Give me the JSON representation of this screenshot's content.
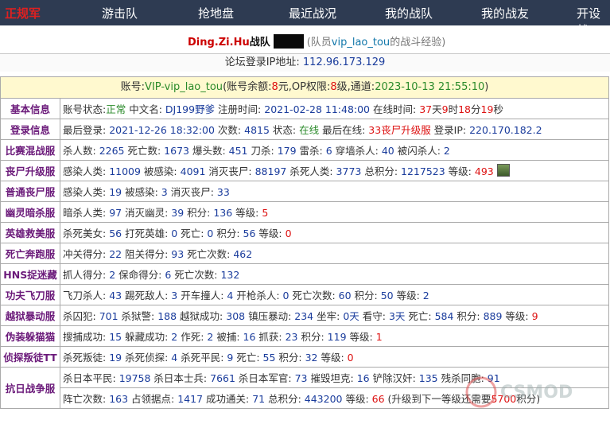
{
  "nav": {
    "logo": "正规军",
    "items": [
      "游击队",
      "抢地盘",
      "最近战况",
      "我的战队",
      "我的战友",
      "开设战"
    ]
  },
  "team": {
    "name": "Ding.Zi.Hu",
    "suffix": "战队",
    "paren_open": "(队员",
    "member": "vip_lao_tou",
    "paren_close": "的战斗经验)"
  },
  "ip": {
    "label": "论坛登录IP地址:",
    "value": "112.96.173.129"
  },
  "account": {
    "l1": "账号:",
    "name": "VIP-vip_lao_tou",
    "l2": "(账号余额:",
    "balance": "8",
    "l3": "元,OP权限:",
    "op": "8",
    "l4": "级,通道:",
    "ts": "2023-10-13 21:55:10",
    "l5": ")"
  },
  "rows": [
    {
      "label": "基本信息",
      "parts": [
        [
          "账号状态:",
          ""
        ],
        [
          "正常",
          "green"
        ],
        [
          " 中文名: ",
          ""
        ],
        [
          "DJ199野爹",
          "blue"
        ],
        [
          " 注册时间: ",
          ""
        ],
        [
          "2021-02-28 11:48:00",
          "blue"
        ],
        [
          " 在线时间: ",
          ""
        ],
        [
          "37",
          "red"
        ],
        [
          "天",
          ""
        ],
        [
          "9",
          "red"
        ],
        [
          "时",
          ""
        ],
        [
          "18",
          "red"
        ],
        [
          "分",
          ""
        ],
        [
          "19",
          "red"
        ],
        [
          "秒",
          ""
        ]
      ]
    },
    {
      "label": "登录信息",
      "parts": [
        [
          "最后登录: ",
          ""
        ],
        [
          "2021-12-26 18:32:00",
          "blue"
        ],
        [
          " 次数: ",
          ""
        ],
        [
          "4815",
          "blue"
        ],
        [
          " 状态: ",
          ""
        ],
        [
          "在线",
          "green"
        ],
        [
          " 最后在线: ",
          ""
        ],
        [
          "33丧尸升级服",
          "red"
        ],
        [
          " 登录IP: ",
          ""
        ],
        [
          "220.170.182.2",
          "blue"
        ]
      ]
    },
    {
      "label": "比赛混战服",
      "parts": [
        [
          "杀人数: ",
          ""
        ],
        [
          "2265",
          "blue"
        ],
        [
          " 死亡数: ",
          ""
        ],
        [
          "1673",
          "blue"
        ],
        [
          " 爆头数: ",
          ""
        ],
        [
          "451",
          "blue"
        ],
        [
          " 刀杀: ",
          ""
        ],
        [
          "179",
          "blue"
        ],
        [
          " 雷杀: ",
          ""
        ],
        [
          "6",
          "blue"
        ],
        [
          " 穿墙杀人: ",
          ""
        ],
        [
          "40",
          "blue"
        ],
        [
          " 被闪杀人: ",
          ""
        ],
        [
          "2",
          "blue"
        ]
      ]
    },
    {
      "label": "丧尸升级服",
      "parts": [
        [
          "感染人类: ",
          ""
        ],
        [
          "11009",
          "blue"
        ],
        [
          " 被感染: ",
          ""
        ],
        [
          "4091",
          "blue"
        ],
        [
          " 消灭丧尸: ",
          ""
        ],
        [
          "88197",
          "blue"
        ],
        [
          " 杀死人类: ",
          ""
        ],
        [
          "3773",
          "blue"
        ],
        [
          " 总积分: ",
          ""
        ],
        [
          "1217523",
          "blue"
        ],
        [
          " 等级: ",
          ""
        ],
        [
          "493",
          "red"
        ]
      ],
      "avatar": true
    },
    {
      "label": "普通丧尸服",
      "parts": [
        [
          "感染人类: ",
          ""
        ],
        [
          "19",
          "blue"
        ],
        [
          " 被感染: ",
          ""
        ],
        [
          "3",
          "blue"
        ],
        [
          " 消灭丧尸: ",
          ""
        ],
        [
          "33",
          "blue"
        ]
      ]
    },
    {
      "label": "幽灵暗杀服",
      "parts": [
        [
          "暗杀人类: ",
          ""
        ],
        [
          "97",
          "blue"
        ],
        [
          " 消灭幽灵: ",
          ""
        ],
        [
          "39",
          "blue"
        ],
        [
          " 积分: ",
          ""
        ],
        [
          "136",
          "blue"
        ],
        [
          " 等级: ",
          ""
        ],
        [
          "5",
          "red"
        ]
      ]
    },
    {
      "label": "英雄救美服",
      "parts": [
        [
          "杀死美女: ",
          ""
        ],
        [
          "56",
          "blue"
        ],
        [
          " 打死英雄: ",
          ""
        ],
        [
          "0",
          "blue"
        ],
        [
          " 死亡: ",
          ""
        ],
        [
          "0",
          "blue"
        ],
        [
          " 积分: ",
          ""
        ],
        [
          "56",
          "blue"
        ],
        [
          " 等级: ",
          ""
        ],
        [
          "0",
          "red"
        ]
      ]
    },
    {
      "label": "死亡奔跑服",
      "parts": [
        [
          "冲关得分: ",
          ""
        ],
        [
          "22",
          "blue"
        ],
        [
          " 阻关得分: ",
          ""
        ],
        [
          "93",
          "blue"
        ],
        [
          " 死亡次数: ",
          ""
        ],
        [
          "462",
          "blue"
        ]
      ]
    },
    {
      "label": "HNS捉迷藏",
      "parts": [
        [
          "抓人得分: ",
          ""
        ],
        [
          "2",
          "blue"
        ],
        [
          " 保命得分: ",
          ""
        ],
        [
          "6",
          "blue"
        ],
        [
          " 死亡次数: ",
          ""
        ],
        [
          "132",
          "blue"
        ]
      ]
    },
    {
      "label": "功夫飞刀服",
      "parts": [
        [
          "飞刀杀人: ",
          ""
        ],
        [
          "43",
          "blue"
        ],
        [
          " 踢死敌人: ",
          ""
        ],
        [
          "3",
          "blue"
        ],
        [
          " 开车撞人: ",
          ""
        ],
        [
          "4",
          "blue"
        ],
        [
          " 开枪杀人: ",
          ""
        ],
        [
          "0",
          "blue"
        ],
        [
          " 死亡次数: ",
          ""
        ],
        [
          "60",
          "blue"
        ],
        [
          " 积分: ",
          ""
        ],
        [
          "50",
          "blue"
        ],
        [
          " 等级: ",
          ""
        ],
        [
          "2",
          "blue"
        ]
      ]
    },
    {
      "label": "越狱暴动服",
      "parts": [
        [
          "杀囚犯: ",
          ""
        ],
        [
          "701",
          "blue"
        ],
        [
          " 杀狱警: ",
          ""
        ],
        [
          "188",
          "blue"
        ],
        [
          " 越狱成功: ",
          ""
        ],
        [
          "308",
          "blue"
        ],
        [
          " 镇压暴动: ",
          ""
        ],
        [
          "234",
          "blue"
        ],
        [
          " 坐牢: ",
          ""
        ],
        [
          "0天",
          "blue"
        ],
        [
          " 看守: ",
          ""
        ],
        [
          "3天",
          "blue"
        ],
        [
          " 死亡: ",
          ""
        ],
        [
          "584",
          "blue"
        ],
        [
          " 积分: ",
          ""
        ],
        [
          "889",
          "blue"
        ],
        [
          " 等级: ",
          ""
        ],
        [
          "9",
          "red"
        ]
      ]
    },
    {
      "label": "伪装躲猫猫",
      "parts": [
        [
          "搜捕成功: ",
          ""
        ],
        [
          "15",
          "blue"
        ],
        [
          " 躲藏成功: ",
          ""
        ],
        [
          "2",
          "blue"
        ],
        [
          " 作死: ",
          ""
        ],
        [
          "2",
          "blue"
        ],
        [
          " 被捕: ",
          ""
        ],
        [
          "16",
          "blue"
        ],
        [
          " 抓获: ",
          ""
        ],
        [
          "23",
          "blue"
        ],
        [
          " 积分: ",
          ""
        ],
        [
          "119",
          "blue"
        ],
        [
          " 等级: ",
          ""
        ],
        [
          "1",
          "red"
        ]
      ]
    },
    {
      "label": "侦探叛徒TT",
      "parts": [
        [
          "杀死叛徒: ",
          ""
        ],
        [
          "19",
          "blue"
        ],
        [
          " 杀死侦探: ",
          ""
        ],
        [
          "4",
          "blue"
        ],
        [
          " 杀死平民: ",
          ""
        ],
        [
          "9",
          "blue"
        ],
        [
          " 死亡: ",
          ""
        ],
        [
          "55",
          "blue"
        ],
        [
          " 积分: ",
          ""
        ],
        [
          "32",
          "blue"
        ],
        [
          " 等级: ",
          ""
        ],
        [
          "0",
          "red"
        ]
      ]
    }
  ],
  "war": {
    "label": "抗日战争服",
    "line1": [
      [
        "杀日本平民: ",
        ""
      ],
      [
        "19758",
        "blue"
      ],
      [
        " 杀日本士兵: ",
        ""
      ],
      [
        "7661",
        "blue"
      ],
      [
        " 杀日本军官: ",
        ""
      ],
      [
        "73",
        "blue"
      ],
      [
        " 摧毁坦克: ",
        ""
      ],
      [
        "16",
        "blue"
      ],
      [
        " 铲除汉奸: ",
        ""
      ],
      [
        "135",
        "blue"
      ],
      [
        " 残杀同胞: ",
        ""
      ],
      [
        "91",
        "blue"
      ]
    ],
    "line2": [
      [
        "阵亡次数: ",
        ""
      ],
      [
        "163",
        "blue"
      ],
      [
        " 占领据点: ",
        ""
      ],
      [
        "1417",
        "blue"
      ],
      [
        " 成功通关: ",
        ""
      ],
      [
        "71",
        "blue"
      ],
      [
        " 总积分: ",
        ""
      ],
      [
        "443200",
        "blue"
      ],
      [
        " 等级: ",
        ""
      ],
      [
        "66",
        "red"
      ],
      [
        " (升级到下一等级还需要",
        ""
      ],
      [
        "5700",
        "red"
      ],
      [
        "积分)",
        ""
      ]
    ]
  },
  "watermark": "CSMOD"
}
